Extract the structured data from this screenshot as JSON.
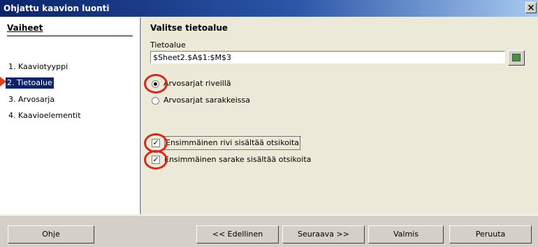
{
  "window": {
    "title": "Ohjattu kaavion luonti",
    "close_glyph": "×"
  },
  "steps": {
    "title": "Vaiheet",
    "items": [
      {
        "label": "1. Kaaviotyyppi"
      },
      {
        "label": "2. Tietoalue",
        "active": true
      },
      {
        "label": "3. Arvosarja"
      },
      {
        "label": "4. Kaavioelementit"
      }
    ]
  },
  "content": {
    "title": "Valitse tietoalue",
    "range_label": "Tietoalue",
    "range_value": "$Sheet2.$A$1:$M$3",
    "radio_rows": {
      "label": "Arvosarjat riveillä",
      "checked": true
    },
    "radio_cols": {
      "label": "Arvosarjat sarakkeissa",
      "checked": false
    },
    "check_first_row": {
      "label": "Ensimmäinen rivi sisältää otsikoita",
      "checked": true
    },
    "check_first_col": {
      "label": "Ensimmäinen sarake sisältää otsikoita",
      "checked": true
    },
    "check_mark": "✓"
  },
  "buttons": {
    "help": "Ohje",
    "back": "<< Edellinen",
    "next": "Seuraava >>",
    "finish": "Valmis",
    "cancel": "Peruuta"
  },
  "colors": {
    "annotation": "#d32b1e",
    "selection": "#0a246a"
  }
}
